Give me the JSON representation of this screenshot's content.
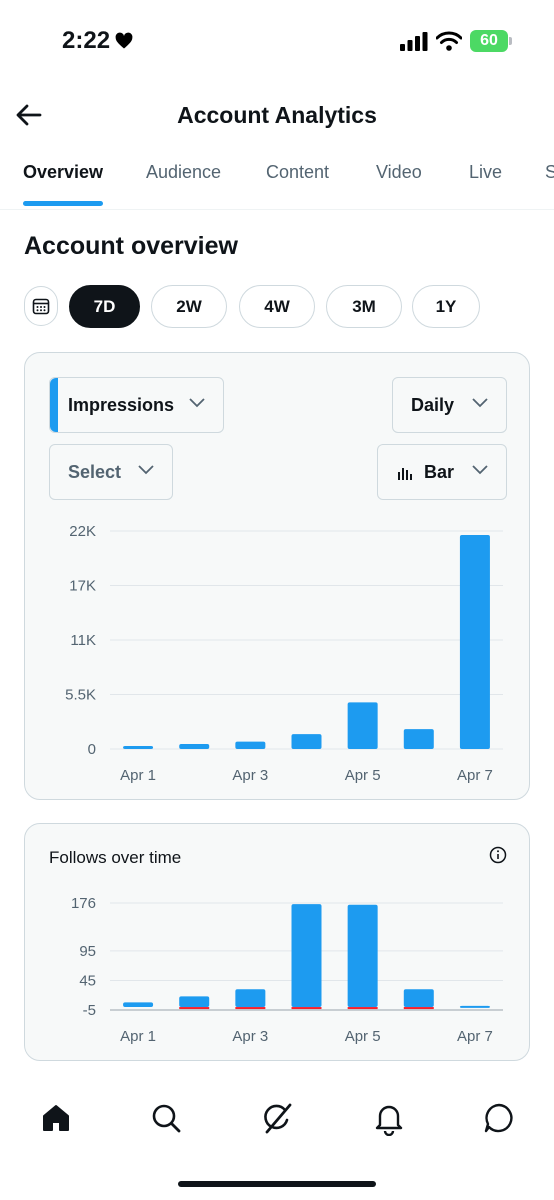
{
  "status_bar": {
    "time": "2:22",
    "battery": "60"
  },
  "header": {
    "title": "Account Analytics"
  },
  "tabs": [
    {
      "label": "Overview",
      "active": true
    },
    {
      "label": "Audience"
    },
    {
      "label": "Content"
    },
    {
      "label": "Video"
    },
    {
      "label": "Live"
    },
    {
      "label": "S"
    }
  ],
  "overview": {
    "title": "Account overview",
    "ranges": [
      "7D",
      "2W",
      "4W",
      "3M",
      "1Y"
    ],
    "selected_range": "7D"
  },
  "impressions_card": {
    "metric_dropdown": "Impressions",
    "interval_dropdown": "Daily",
    "compare_dropdown": "Select",
    "chart_type_dropdown": "Bar"
  },
  "follows_card": {
    "title": "Follows over time"
  },
  "colors": {
    "accent": "#1d9bf0",
    "negative": "#f4212e",
    "text": "#0f1419",
    "muted": "#536471"
  },
  "chart_data": [
    {
      "type": "bar",
      "categories": [
        "Apr 1",
        "Apr 2",
        "Apr 3",
        "Apr 4",
        "Apr 5",
        "Apr 6",
        "Apr 7"
      ],
      "x_tick_labels": [
        "Apr 1",
        "Apr 3",
        "Apr 5",
        "Apr 7"
      ],
      "values": [
        300,
        500,
        750,
        1500,
        4700,
        2000,
        21600
      ],
      "y_ticks": [
        "22K",
        "17K",
        "11K",
        "5.5K",
        "0"
      ],
      "y_tick_values": [
        22000,
        16500,
        11000,
        5500,
        0
      ],
      "ylim": [
        0,
        22000
      ],
      "grid": true
    },
    {
      "type": "bar",
      "title": "Follows over time",
      "categories": [
        "Apr 1",
        "Apr 2",
        "Apr 3",
        "Apr 4",
        "Apr 5",
        "Apr 6",
        "Apr 7"
      ],
      "x_tick_labels": [
        "Apr 1",
        "Apr 3",
        "Apr 5",
        "Apr 7"
      ],
      "series": [
        {
          "values": [
            8,
            18,
            30,
            174,
            173,
            30,
            2
          ]
        },
        {
          "values": [
            0,
            -1,
            -2,
            -2,
            -3,
            -2,
            0
          ]
        }
      ],
      "y_ticks": [
        "176",
        "95",
        "45",
        "-5"
      ],
      "y_tick_values": [
        176,
        95,
        45,
        -5
      ],
      "ylim": [
        -5,
        176
      ],
      "grid": true
    }
  ]
}
